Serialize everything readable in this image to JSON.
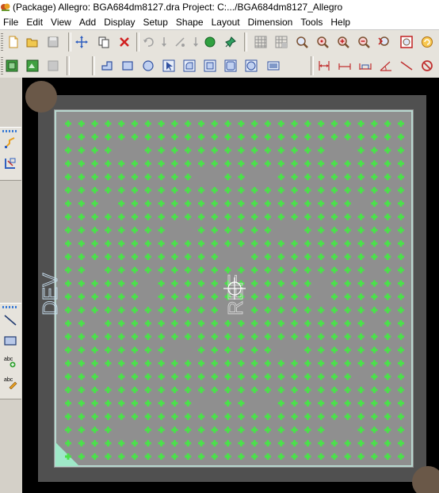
{
  "window": {
    "title": "(Package) Allegro: BGA684dm8127.dra  Project: C:.../BGA684dm8127_Allegro"
  },
  "menubar": {
    "items": [
      {
        "label": "File",
        "key": "F",
        "rest": "ile"
      },
      {
        "label": "Edit",
        "key": "E",
        "rest": "dit"
      },
      {
        "label": "View",
        "key": "V",
        "rest": "iew"
      },
      {
        "label": "Add",
        "key": "A",
        "rest": "dd"
      },
      {
        "label": "Display",
        "key": "D",
        "rest": "isplay"
      },
      {
        "label": "Setup",
        "key": "S",
        "rest": "etup"
      },
      {
        "label": "Shape",
        "key": "S",
        "rest": "hape"
      },
      {
        "label": "Layout",
        "key": "L",
        "rest": "ayout"
      },
      {
        "label": "Dimension",
        "pre": "D",
        "key": "i",
        "rest": "mension"
      },
      {
        "label": "Tools",
        "key": "T",
        "rest": "ools"
      },
      {
        "label": "Help",
        "key": "H",
        "rest": "elp"
      }
    ]
  },
  "toolbar1": {
    "icons": [
      "new-file-icon",
      "open-folder-icon",
      "save-icon",
      "move-icon",
      "copy-icon",
      "delete-icon",
      "undo-icon",
      "redo-icon",
      "unrule-icon",
      "rotate-icon",
      "shape-icon",
      "pin-icon",
      "grid-icon",
      "grid-toggle-icon",
      "zoom-fit-icon",
      "zoom-points-icon",
      "zoom-in-icon",
      "zoom-out-icon",
      "zoom-previous-icon",
      "zoom-world-icon",
      "refresh-icon"
    ]
  },
  "toolbar2": {
    "icons": [
      "layer-visibility-icon",
      "color-icon",
      "disabled-icon",
      "corner-shape-icon",
      "rectangle-icon",
      "circle-icon",
      "select-arrow-icon",
      "rounded-rect-icon",
      "rotated-rect-icon",
      "square-icon",
      "oblong-icon",
      "button-shape-icon",
      "dimension-linear-icon",
      "dimension-horizontal-icon",
      "dimension-datum-icon",
      "dimension-angle-icon",
      "diagonal-line-icon",
      "no-icon"
    ]
  },
  "leftpanel": {
    "group1": [
      "route-icon",
      "fanout-icon"
    ],
    "group2": [
      "line-icon",
      "rectangle-icon",
      "add-text-icon",
      "edit-text-icon"
    ]
  },
  "canvas": {
    "labels": {
      "ref_text": "REF",
      "dev_text": "DEV"
    },
    "colors": {
      "background": "#000000",
      "outer_frame": "#505050",
      "body": "#8f8f8f",
      "outline": "#b8d8d0",
      "pin": "#49e349",
      "pin1_marker": "#9fe8c8",
      "corner_pad": "#6a5848"
    },
    "grid": {
      "rows": 26,
      "cols": 26,
      "missing": [
        [
          2,
          4
        ],
        [
          2,
          5
        ],
        [
          2,
          20
        ],
        [
          2,
          21
        ],
        [
          4,
          10
        ],
        [
          4,
          11
        ],
        [
          4,
          14
        ],
        [
          4,
          15
        ],
        [
          6,
          3
        ],
        [
          6,
          22
        ],
        [
          8,
          8
        ],
        [
          8,
          9
        ],
        [
          8,
          16
        ],
        [
          8,
          17
        ],
        [
          10,
          12
        ],
        [
          10,
          13
        ],
        [
          11,
          2
        ],
        [
          11,
          23
        ],
        [
          12,
          6
        ],
        [
          12,
          19
        ],
        [
          13,
          6
        ],
        [
          13,
          19
        ],
        [
          14,
          12
        ],
        [
          14,
          13
        ],
        [
          15,
          2
        ],
        [
          15,
          23
        ],
        [
          17,
          8
        ],
        [
          17,
          9
        ],
        [
          17,
          16
        ],
        [
          17,
          17
        ],
        [
          19,
          3
        ],
        [
          19,
          22
        ],
        [
          21,
          10
        ],
        [
          21,
          11
        ],
        [
          21,
          14
        ],
        [
          21,
          15
        ],
        [
          23,
          4
        ],
        [
          23,
          5
        ],
        [
          23,
          20
        ],
        [
          23,
          21
        ]
      ]
    }
  }
}
